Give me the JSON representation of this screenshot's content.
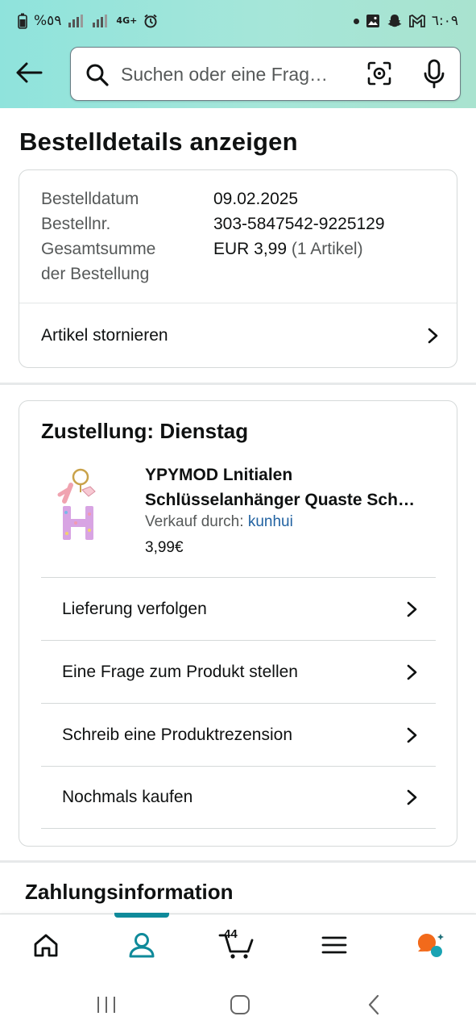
{
  "status_bar": {
    "battery_text": "%٥٩",
    "network_text": "4G+",
    "time": "٦:٠٩"
  },
  "search": {
    "placeholder": "Suchen oder eine Frag…"
  },
  "page": {
    "title": "Bestelldetails anzeigen"
  },
  "order_summary": {
    "date_label": "Bestelldatum",
    "date_value": "09.02.2025",
    "number_label": "Bestellnr.",
    "number_value": "303-5847542-9225129",
    "total_label_line1": "Gesamtsumme",
    "total_label_line2": "der Bestellung",
    "total_value": "EUR 3,99",
    "total_items": "(1 Artikel)",
    "cancel_label": "Artikel stornieren"
  },
  "delivery": {
    "title": "Zustellung: Dienstag",
    "product_title_line1": "YPYMOD Lnitialen",
    "product_title_line2": "Schlüsselanhänger Quaste Sch…",
    "seller_prefix": "Verkauf durch:",
    "seller_name": "kunhui",
    "price": "3,99€",
    "actions": [
      {
        "label": "Lieferung verfolgen"
      },
      {
        "label": "Eine Frage zum Produkt stellen"
      },
      {
        "label": "Schreib eine Produktrezension"
      },
      {
        "label": "Nochmals kaufen"
      }
    ]
  },
  "payment": {
    "title": "Zahlungsinformation"
  },
  "bottom_nav": {
    "cart_count": "44",
    "accent_color": "#0f8a9a",
    "items": [
      "home-icon",
      "account-icon",
      "cart-icon",
      "menu-icon",
      "rufus-icon"
    ]
  },
  "system_nav": [
    "recents",
    "home",
    "back"
  ]
}
